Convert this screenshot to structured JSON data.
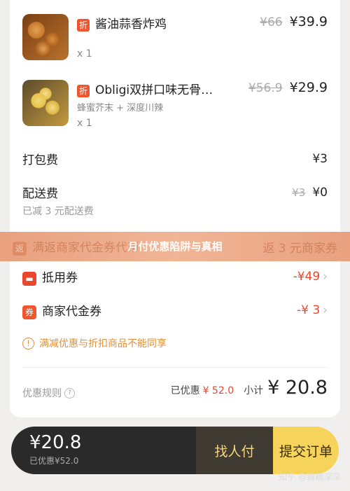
{
  "items": [
    {
      "tag": "折",
      "name": "酱油蒜香炸鸡",
      "sub": "",
      "qty": "x 1",
      "orig": "¥66",
      "price": "¥39.9"
    },
    {
      "tag": "折",
      "name": "Obligi双拼口味无骨…",
      "sub": "蜂蜜芥末 + 深度川辣",
      "qty": "x 1",
      "orig": "¥56.9",
      "price": "¥29.9"
    }
  ],
  "packing": {
    "label": "打包费",
    "value": "¥3"
  },
  "delivery": {
    "label": "配送费",
    "orig": "¥3",
    "value": "¥0",
    "note": "已减 3 元配送费"
  },
  "promo": {
    "label": "满返商家代金券代币",
    "value": "返 3 元商家券",
    "icon": "返"
  },
  "banner_title": "月付优惠陷阱与真相",
  "coupon": {
    "label": "抵用券",
    "value": "-¥49"
  },
  "voucher": {
    "label": "商家代金券",
    "value": "-¥ 3",
    "icon": "券"
  },
  "warning": "满减优惠与折扣商品不能同享",
  "summary": {
    "rules": "优惠规则",
    "discount_label": "已优惠",
    "discount": "¥ 52.0",
    "subtotal_label": "小计",
    "subtotal": "¥ 20.8"
  },
  "bottom": {
    "total": "¥20.8",
    "saved": "已优惠¥52.0",
    "find_pay": "找人付",
    "submit": "提交订单"
  },
  "watermark": "知乎 @藕藕深深",
  "colors": {
    "accent": "#e8472e",
    "submit": "#f6d35a"
  }
}
